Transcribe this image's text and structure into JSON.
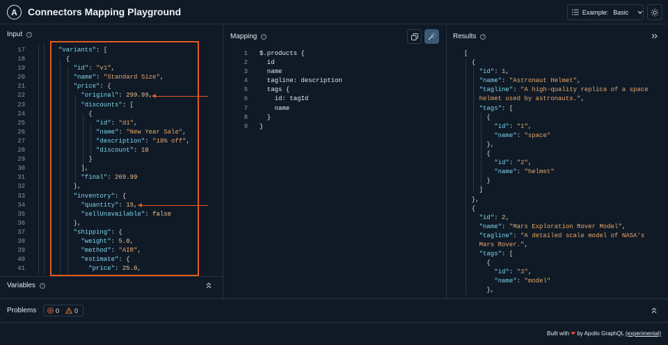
{
  "app": {
    "logo_letter": "A",
    "title": "Connectors Mapping Playground"
  },
  "header": {
    "example_label": "Example:",
    "example_value": "Basic"
  },
  "panels": {
    "input": "Input",
    "mapping": "Mapping",
    "results": "Results",
    "variables": "Variables",
    "problems": "Problems"
  },
  "problems": {
    "errors": "0",
    "warnings": "0"
  },
  "footer": {
    "built_with": "Built with",
    "by": "by Apollo GraphQL",
    "experimental": "(experimental)"
  },
  "input_lines": [
    "17",
    "18",
    "19",
    "20",
    "21",
    "22",
    "23",
    "24",
    "25",
    "26",
    "27",
    "28",
    "29",
    "30",
    "31",
    "32",
    "33",
    "34",
    "35",
    "36",
    "37",
    "38",
    "39",
    "40",
    "41"
  ],
  "input_code": [
    [
      [
        "k",
        "\"variants\""
      ],
      [
        "p",
        ": ["
      ]
    ],
    [
      [
        "p",
        "  {"
      ]
    ],
    [
      [
        "p",
        "    "
      ],
      [
        "k",
        "\"id\""
      ],
      [
        "p",
        ": "
      ],
      [
        "s",
        "\"v1\""
      ],
      [
        "p",
        ","
      ]
    ],
    [
      [
        "p",
        "    "
      ],
      [
        "k",
        "\"name\""
      ],
      [
        "p",
        ": "
      ],
      [
        "s",
        "\"Standard Size\""
      ],
      [
        "p",
        ","
      ]
    ],
    [
      [
        "p",
        "    "
      ],
      [
        "k",
        "\"price\""
      ],
      [
        "p",
        ": {"
      ]
    ],
    [
      [
        "p",
        "      "
      ],
      [
        "k",
        "\"original\""
      ],
      [
        "p",
        ": "
      ],
      [
        "n",
        "299.99"
      ],
      [
        "p",
        ","
      ]
    ],
    [
      [
        "p",
        "      "
      ],
      [
        "k",
        "\"discounts\""
      ],
      [
        "p",
        ": ["
      ]
    ],
    [
      [
        "p",
        "        {"
      ]
    ],
    [
      [
        "p",
        "          "
      ],
      [
        "k",
        "\"id\""
      ],
      [
        "p",
        ": "
      ],
      [
        "s",
        "\"d1\""
      ],
      [
        "p",
        ","
      ]
    ],
    [
      [
        "p",
        "          "
      ],
      [
        "k",
        "\"name\""
      ],
      [
        "p",
        ": "
      ],
      [
        "s",
        "\"New Year Sale\""
      ],
      [
        "p",
        ","
      ]
    ],
    [
      [
        "p",
        "          "
      ],
      [
        "k",
        "\"description\""
      ],
      [
        "p",
        ": "
      ],
      [
        "s",
        "\"10% off\""
      ],
      [
        "p",
        ","
      ]
    ],
    [
      [
        "p",
        "          "
      ],
      [
        "k",
        "\"discount\""
      ],
      [
        "p",
        ": "
      ],
      [
        "n",
        "10"
      ]
    ],
    [
      [
        "p",
        "        }"
      ]
    ],
    [
      [
        "p",
        "      ],"
      ]
    ],
    [
      [
        "p",
        "      "
      ],
      [
        "k",
        "\"final\""
      ],
      [
        "p",
        ": "
      ],
      [
        "n",
        "269.99"
      ]
    ],
    [
      [
        "p",
        "    },"
      ]
    ],
    [
      [
        "p",
        "    "
      ],
      [
        "k",
        "\"inventory\""
      ],
      [
        "p",
        ": {"
      ]
    ],
    [
      [
        "p",
        "      "
      ],
      [
        "k",
        "\"quantity\""
      ],
      [
        "p",
        ": "
      ],
      [
        "n",
        "15"
      ],
      [
        "p",
        ","
      ]
    ],
    [
      [
        "p",
        "      "
      ],
      [
        "k",
        "\"sellUnavailable\""
      ],
      [
        "p",
        ": "
      ],
      [
        "n",
        "false"
      ]
    ],
    [
      [
        "p",
        "    },"
      ]
    ],
    [
      [
        "p",
        "    "
      ],
      [
        "k",
        "\"shipping\""
      ],
      [
        "p",
        ": {"
      ]
    ],
    [
      [
        "p",
        "      "
      ],
      [
        "k",
        "\"weight\""
      ],
      [
        "p",
        ": "
      ],
      [
        "n",
        "5.0"
      ],
      [
        "p",
        ","
      ]
    ],
    [
      [
        "p",
        "      "
      ],
      [
        "k",
        "\"method\""
      ],
      [
        "p",
        ": "
      ],
      [
        "s",
        "\"AIR\""
      ],
      [
        "p",
        ","
      ]
    ],
    [
      [
        "p",
        "      "
      ],
      [
        "k",
        "\"estimate\""
      ],
      [
        "p",
        ": {"
      ]
    ],
    [
      [
        "p",
        "        "
      ],
      [
        "k",
        "\"price\""
      ],
      [
        "p",
        ": "
      ],
      [
        "n",
        "25.0"
      ],
      [
        "p",
        ","
      ]
    ]
  ],
  "mapping_lines": [
    "1",
    "2",
    "3",
    "4",
    "5",
    "6",
    "7",
    "8",
    "9"
  ],
  "mapping_code": [
    [
      [
        "m",
        "$.products {"
      ]
    ],
    [
      [
        "m",
        "  id"
      ]
    ],
    [
      [
        "m",
        "  name"
      ]
    ],
    [
      [
        "m",
        "  tagline: description"
      ]
    ],
    [
      [
        "m",
        "  tags {"
      ]
    ],
    [
      [
        "m",
        "    id: tagId"
      ]
    ],
    [
      [
        "m",
        "    name"
      ]
    ],
    [
      [
        "m",
        "  }"
      ]
    ],
    [
      [
        "m",
        "}"
      ]
    ]
  ],
  "results_code": [
    [
      [
        "p",
        "["
      ]
    ],
    [
      [
        "p",
        "  {"
      ]
    ],
    [
      [
        "p",
        "    "
      ],
      [
        "k",
        "\"id\""
      ],
      [
        "p",
        ": "
      ],
      [
        "n",
        "1"
      ],
      [
        "p",
        ","
      ]
    ],
    [
      [
        "p",
        "    "
      ],
      [
        "k",
        "\"name\""
      ],
      [
        "p",
        ": "
      ],
      [
        "s",
        "\"Astronaut Helmet\""
      ],
      [
        "p",
        ","
      ]
    ],
    [
      [
        "p",
        "    "
      ],
      [
        "k",
        "\"tagline\""
      ],
      [
        "p",
        ": "
      ],
      [
        "s",
        "\"A high-quality replica of a space"
      ]
    ],
    [
      [
        "s",
        "    helmet used by astronauts.\""
      ],
      [
        "p",
        ","
      ]
    ],
    [
      [
        "p",
        "    "
      ],
      [
        "k",
        "\"tags\""
      ],
      [
        "p",
        ": ["
      ]
    ],
    [
      [
        "p",
        "      {"
      ]
    ],
    [
      [
        "p",
        "        "
      ],
      [
        "k",
        "\"id\""
      ],
      [
        "p",
        ": "
      ],
      [
        "s",
        "\"1\""
      ],
      [
        "p",
        ","
      ]
    ],
    [
      [
        "p",
        "        "
      ],
      [
        "k",
        "\"name\""
      ],
      [
        "p",
        ": "
      ],
      [
        "s",
        "\"space\""
      ]
    ],
    [
      [
        "p",
        "      },"
      ]
    ],
    [
      [
        "p",
        "      {"
      ]
    ],
    [
      [
        "p",
        "        "
      ],
      [
        "k",
        "\"id\""
      ],
      [
        "p",
        ": "
      ],
      [
        "s",
        "\"2\""
      ],
      [
        "p",
        ","
      ]
    ],
    [
      [
        "p",
        "        "
      ],
      [
        "k",
        "\"name\""
      ],
      [
        "p",
        ": "
      ],
      [
        "s",
        "\"helmet\""
      ]
    ],
    [
      [
        "p",
        "      }"
      ]
    ],
    [
      [
        "p",
        "    ]"
      ]
    ],
    [
      [
        "p",
        "  },"
      ]
    ],
    [
      [
        "p",
        "  {"
      ]
    ],
    [
      [
        "p",
        "    "
      ],
      [
        "k",
        "\"id\""
      ],
      [
        "p",
        ": "
      ],
      [
        "n",
        "2"
      ],
      [
        "p",
        ","
      ]
    ],
    [
      [
        "p",
        "    "
      ],
      [
        "k",
        "\"name\""
      ],
      [
        "p",
        ": "
      ],
      [
        "s",
        "\"Mars Exploration Rover Model\""
      ],
      [
        "p",
        ","
      ]
    ],
    [
      [
        "p",
        "    "
      ],
      [
        "k",
        "\"tagline\""
      ],
      [
        "p",
        ": "
      ],
      [
        "s",
        "\"A detailed scale model of NASA's"
      ]
    ],
    [
      [
        "s",
        "    Mars Rover.\""
      ],
      [
        "p",
        ","
      ]
    ],
    [
      [
        "p",
        "    "
      ],
      [
        "k",
        "\"tags\""
      ],
      [
        "p",
        ": ["
      ]
    ],
    [
      [
        "p",
        "      {"
      ]
    ],
    [
      [
        "p",
        "        "
      ],
      [
        "k",
        "\"id\""
      ],
      [
        "p",
        ": "
      ],
      [
        "s",
        "\"3\""
      ],
      [
        "p",
        ","
      ]
    ],
    [
      [
        "p",
        "        "
      ],
      [
        "k",
        "\"name\""
      ],
      [
        "p",
        ": "
      ],
      [
        "s",
        "\"model\""
      ]
    ],
    [
      [
        "p",
        "      },"
      ]
    ]
  ]
}
